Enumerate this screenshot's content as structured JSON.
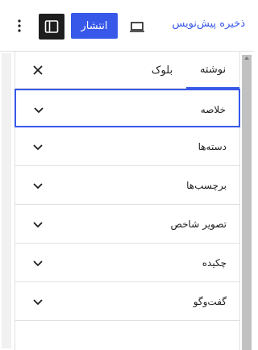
{
  "toolbar": {
    "save_draft_label": "ذخیره پیش‌نویس",
    "publish_label": "انتشار"
  },
  "sidebar": {
    "tabs": [
      {
        "label": "نوشته",
        "active": true
      },
      {
        "label": "بلوک",
        "active": false
      }
    ],
    "panels": [
      {
        "label": "خلاصه",
        "focused": true
      },
      {
        "label": "دسته‌ها",
        "focused": false
      },
      {
        "label": "برچسب‌ها",
        "focused": false
      },
      {
        "label": "تصویر شاخص",
        "focused": false
      },
      {
        "label": "چکیده",
        "focused": false
      },
      {
        "label": "گفت‌وگو",
        "focused": false
      }
    ]
  },
  "colors": {
    "accent": "#3858e9",
    "dark": "#1e1e1e",
    "border": "#e0e0e0"
  },
  "icons": [
    "more-vertical-icon",
    "sidebar-settings-icon",
    "desktop-preview-icon",
    "close-icon",
    "chevron-down-icon"
  ]
}
